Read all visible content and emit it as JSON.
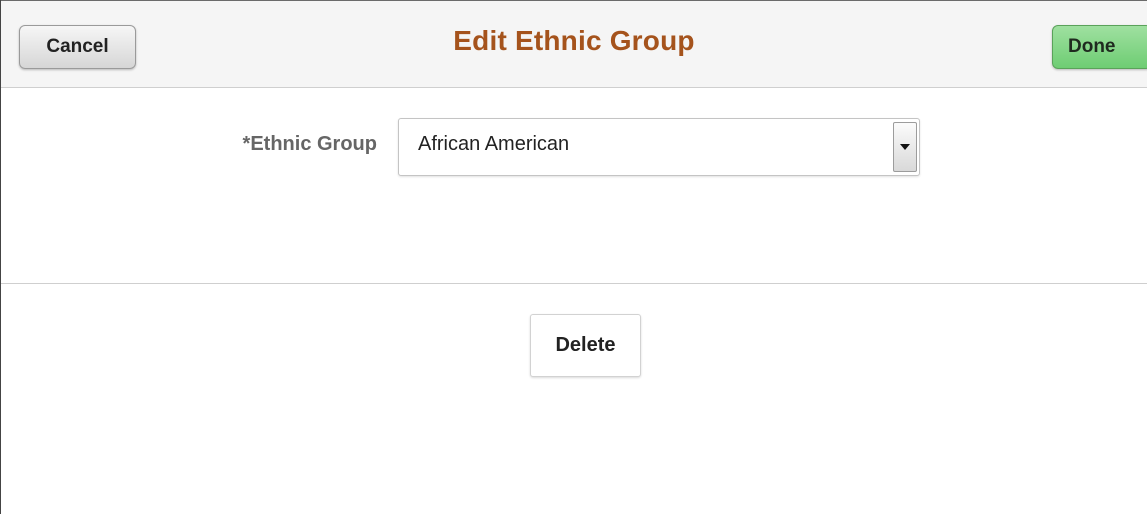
{
  "header": {
    "title": "Edit Ethnic Group",
    "cancel_label": "Cancel",
    "done_label": "Done"
  },
  "form": {
    "ethnic_group": {
      "label": "*Ethnic Group",
      "selected_value": "African American",
      "arrow_icon": "dropdown-arrow-icon"
    }
  },
  "actions": {
    "delete_label": "Delete"
  },
  "colors": {
    "title": "#a5531c",
    "done_button": "#7ed483",
    "label": "#666666"
  }
}
